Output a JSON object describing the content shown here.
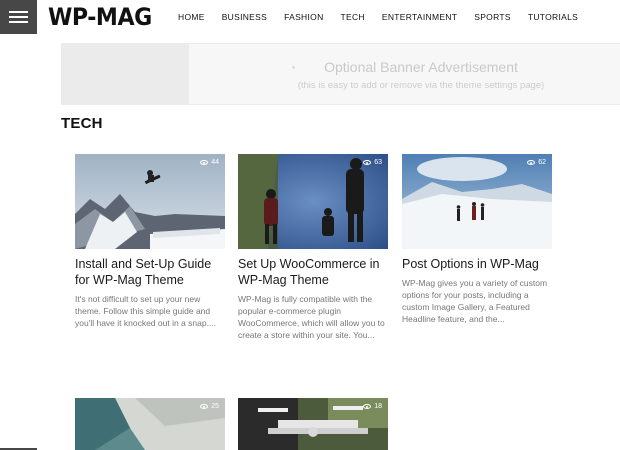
{
  "header": {
    "logo": "WP-MAG",
    "nav": [
      "HOME",
      "BUSINESS",
      "FASHION",
      "TECH",
      "ENTERTAINMENT",
      "SPORTS",
      "TUTORIALS"
    ]
  },
  "banner": {
    "title": "Optional Banner Advertisement",
    "subtitle": "(this is easy to add or remove via the theme settings page)"
  },
  "section": {
    "title": "TECH"
  },
  "posts": [
    {
      "views": "44",
      "title": "Install and Set-Up Guide for WP-Mag Theme",
      "excerpt": "It's not difficult to set up your new theme. Follow this simple guide and you'll have it knocked out in a snap...."
    },
    {
      "views": "63",
      "title": "Set Up WooCommerce in WP-Mag Theme",
      "excerpt": "WP-Mag is fully compatible with the popular e-commerce plugin WooCommerce, which will allow you to create a store within your site. You..."
    },
    {
      "views": "62",
      "title": "Post Options in WP-Mag",
      "excerpt": "WP-Mag gives you a variety of custom options for your posts, including a custom Image Gallery, a Featured Headline feature, and the..."
    },
    {
      "views": "25",
      "title": "",
      "excerpt": ""
    },
    {
      "views": "18",
      "title": "",
      "excerpt": ""
    }
  ],
  "colors": {
    "header_button": "#474747",
    "accent_text": "#1a1a1a",
    "excerpt": "#777777"
  }
}
